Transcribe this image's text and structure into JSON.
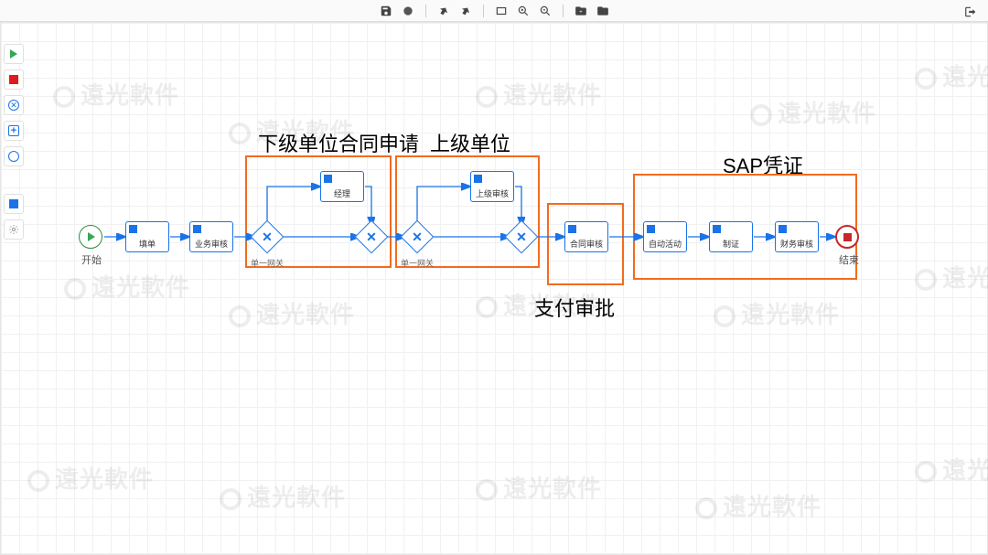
{
  "toolbar": {
    "save": "save",
    "validate": "validate",
    "undo": "undo",
    "redo": "redo",
    "fit": "fit",
    "zoom_in": "zoom-in",
    "zoom_out": "zoom-out",
    "folder_add": "folder-add",
    "folder": "folder",
    "exit": "exit"
  },
  "palette": {
    "start": "start-event",
    "end": "end-event",
    "gateway": "exclusive-gateway",
    "plus": "intermediate-event",
    "service": "service-task",
    "user": "user-task",
    "settings": "settings"
  },
  "annotations": {
    "box1_label": "下级单位合同申请",
    "box2_label": "上级单位",
    "box3_label": "支付审批",
    "box4_label": "SAP凭证"
  },
  "nodes": {
    "start_label": "开始",
    "end_label": "结束",
    "task1": "填单",
    "task2": "业务审核",
    "task3": "经理",
    "task4": "上级审核",
    "task5": "合同审核",
    "task6": "自动活动",
    "task7": "制证",
    "task8": "财务审核",
    "gw1_label": "单一网关",
    "gw3_label": "单一网关"
  },
  "watermark_text": "遠光軟件"
}
